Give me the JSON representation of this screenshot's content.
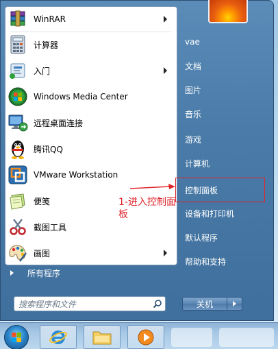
{
  "start_menu": {
    "programs": [
      {
        "label": "WinRAR",
        "icon": "winrar-icon",
        "has_submenu": true
      },
      {
        "label": "计算器",
        "icon": "calculator-icon",
        "has_submenu": false
      },
      {
        "label": "入门",
        "icon": "getting-started-icon",
        "has_submenu": true
      },
      {
        "label": "Windows Media Center",
        "icon": "media-center-icon",
        "has_submenu": false
      },
      {
        "label": "远程桌面连接",
        "icon": "remote-desktop-icon",
        "has_submenu": false
      },
      {
        "label": "腾讯QQ",
        "icon": "qq-penguin-icon",
        "has_submenu": false
      },
      {
        "label": "VMware Workstation",
        "icon": "vmware-icon",
        "has_submenu": false
      },
      {
        "label": "便笺",
        "icon": "sticky-notes-icon",
        "has_submenu": false
      },
      {
        "label": "截图工具",
        "icon": "snipping-tool-icon",
        "has_submenu": false
      },
      {
        "label": "画图",
        "icon": "paint-icon",
        "has_submenu": true
      }
    ],
    "all_programs_label": "所有程序",
    "search_placeholder": "搜索程序和文件",
    "right_items": [
      {
        "label": "vae"
      },
      {
        "label": "文档"
      },
      {
        "label": "图片"
      },
      {
        "label": "音乐"
      },
      {
        "label": "游戏"
      },
      {
        "label": "计算机"
      },
      {
        "label": "控制面板"
      },
      {
        "label": "设备和打印机"
      },
      {
        "label": "默认程序"
      },
      {
        "label": "帮助和支持"
      }
    ],
    "shutdown_label": "关机"
  },
  "annotation": {
    "text": "1-进入控制面板",
    "color": "#e0262c"
  }
}
